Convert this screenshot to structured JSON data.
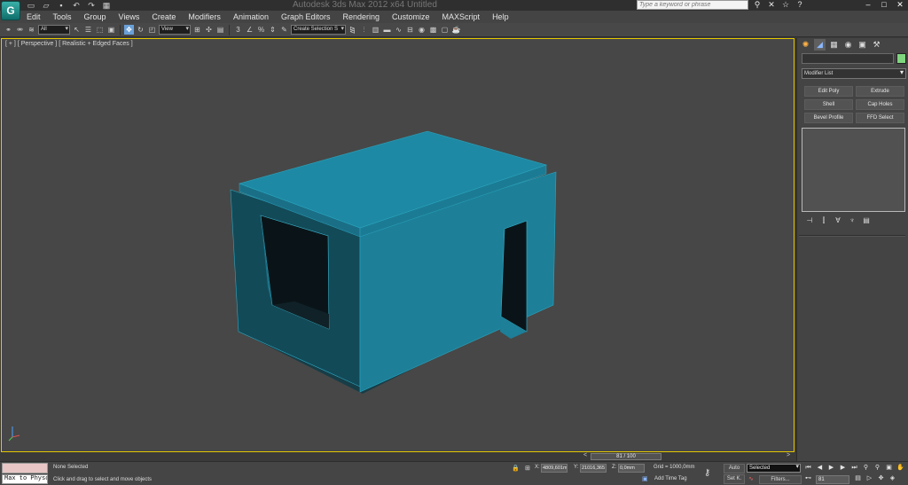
{
  "titlebar": {
    "logo": "G",
    "title": "Autodesk 3ds Max  2012 x64      Untitled",
    "search_placeholder": "Type a keyword or phrase",
    "quick_access": [
      "new-icon",
      "open-icon",
      "save-icon",
      "undo-icon",
      "redo-icon",
      "project-icon"
    ],
    "right_icons": [
      "binoculars-icon",
      "communication-icon",
      "star-icon",
      "help-icon"
    ],
    "window_controls": [
      "minimize",
      "maximize",
      "close"
    ]
  },
  "menubar": {
    "items": [
      "Edit",
      "Tools",
      "Group",
      "Views",
      "Create",
      "Modifiers",
      "Animation",
      "Graph Editors",
      "Rendering",
      "Customize",
      "MAXScript",
      "Help"
    ]
  },
  "toolbar": {
    "selection_filter": "All",
    "reference_coord": "View",
    "named_selection": "Create Selection S"
  },
  "viewport": {
    "label_plus": "[ + ]",
    "label_view": "[ Perspective ]",
    "label_shading": "[ Realistic + Edged Faces ]",
    "border_color": "#e6c800",
    "object_color": "#1d7f98"
  },
  "command_panel": {
    "tabs": [
      "create-icon",
      "modify-icon",
      "hierarchy-icon",
      "motion-icon",
      "display-icon",
      "utilities-icon"
    ],
    "name_value": "",
    "object_color": "#7fd67f",
    "modifier_list": "Modifier List",
    "modifier_buttons": [
      "Edit Poly",
      "Extrude",
      "Shell",
      "Cap Holes",
      "Bevel Profile",
      "FFD Select"
    ]
  },
  "timeslider": {
    "frame_label": "81 / 100",
    "current_frame": 81,
    "total_frames": 100
  },
  "statusbar": {
    "maxscript_label": "Max to Physc",
    "selection_status": "None Selected",
    "prompt": "Click and drag to select and move objects",
    "x_label": "X:",
    "x_value": "4809,601m",
    "y_label": "Y:",
    "y_value": "21016,365",
    "z_label": "Z:",
    "z_value": "0,0mm",
    "grid": "Grid = 1000,0mm",
    "add_time_tag": "Add Time Tag",
    "auto_key": "Auto",
    "set_key": "Set K.",
    "selected": "Selected",
    "filters": "Filters...",
    "frame": "81"
  }
}
